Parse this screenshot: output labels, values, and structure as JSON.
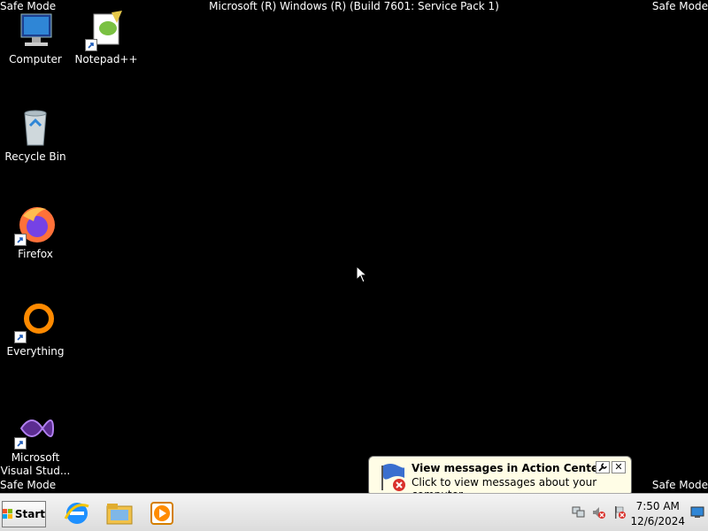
{
  "screen": {
    "safe_mode_tl": "Safe Mode",
    "safe_mode_tr": "Safe Mode",
    "safe_mode_bl": "Safe Mode",
    "safe_mode_br": "Safe Mode",
    "title": "Microsoft (R) Windows (R) (Build 7601: Service Pack 1)"
  },
  "desktop": {
    "icons": [
      {
        "label": "Computer",
        "icon": "computer-icon"
      },
      {
        "label": "Notepad++",
        "icon": "notepadpp-icon"
      },
      {
        "label": "Recycle Bin",
        "icon": "recycle-bin-icon"
      },
      {
        "label": "Firefox",
        "icon": "firefox-icon"
      },
      {
        "label": "Everything",
        "icon": "everything-icon"
      },
      {
        "label": "Microsoft Visual Stud...",
        "icon": "visual-studio-icon"
      }
    ]
  },
  "taskbar": {
    "start_label": "Start",
    "pinned": [
      "internet-explorer-icon",
      "file-explorer-icon",
      "media-player-icon"
    ],
    "clock_time": "7:50 AM",
    "clock_date": "12/6/2024"
  },
  "balloon": {
    "title": "View messages in Action Center",
    "body": "Click to view messages about your computer.",
    "close_label": "✕"
  }
}
